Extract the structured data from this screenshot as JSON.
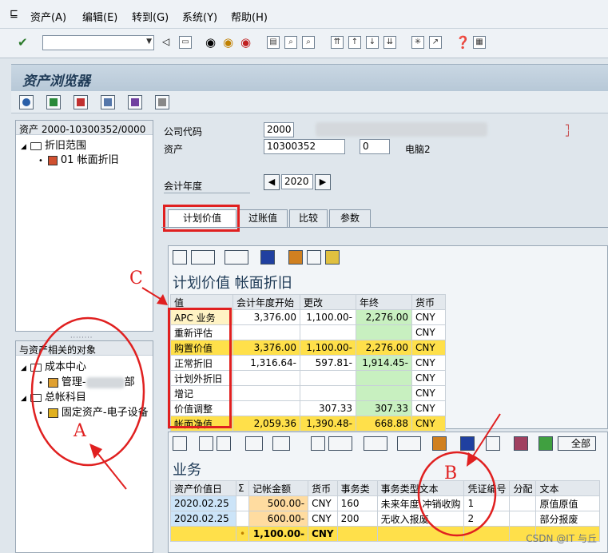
{
  "menu": [
    "资产(A)",
    "编辑(E)",
    "转到(G)",
    "系统(Y)",
    "帮助(H)"
  ],
  "title": "资产浏览器",
  "left_tree": {
    "header": "资产 2000-10300352/0000",
    "node1": "折旧范围",
    "node1_child": "01 帐面折旧"
  },
  "left_tree2": {
    "header": "与资产相关的对象",
    "node1": "成本中心",
    "node1_child_prefix": "管理-",
    "node1_child_suffix": "部",
    "node2": "总帐科目",
    "node2_child": "固定资产-电子设备"
  },
  "form": {
    "company_code_label": "公司代码",
    "company_code": "2000",
    "asset_label": "资产",
    "asset_number": "10300352",
    "asset_sub": "0",
    "asset_desc": "电脑2",
    "fiscal_year_label": "会计年度",
    "fiscal_year": "2020"
  },
  "tabs": [
    "计划价值",
    "过账值",
    "比较",
    "参数"
  ],
  "plan_section": {
    "title": "计划价值 帐面折旧",
    "headers": [
      "值",
      "会计年度开始",
      "更改",
      "年终",
      "货币"
    ],
    "rows": [
      {
        "label": "APC 业务",
        "start": "3,376.00",
        "change": "1,100.00-",
        "end": "2,276.00",
        "cur": "CNY"
      },
      {
        "label": "重新评估",
        "start": "",
        "change": "",
        "end": "",
        "cur": "CNY"
      },
      {
        "label": "购置价值",
        "start": "3,376.00",
        "change": "1,100.00-",
        "end": "2,276.00",
        "cur": "CNY"
      },
      {
        "label": "正常折旧",
        "start": "1,316.64-",
        "change": "597.81-",
        "end": "1,914.45-",
        "cur": "CNY"
      },
      {
        "label": "计划外折旧",
        "start": "",
        "change": "",
        "end": "",
        "cur": "CNY"
      },
      {
        "label": "增记",
        "start": "",
        "change": "",
        "end": "",
        "cur": "CNY"
      },
      {
        "label": "价值调整",
        "start": "",
        "change": "307.33",
        "end": "307.33",
        "cur": "CNY"
      },
      {
        "label": "帐面净值",
        "start": "2,059.36",
        "change": "1,390.48-",
        "end": "668.88",
        "cur": "CNY"
      }
    ]
  },
  "trans_section": {
    "title": "业务",
    "all_button": "全部",
    "headers": [
      "资产价值日",
      "Σ",
      "记帐金额",
      "货币",
      "事务类",
      "事务类型文本",
      "凭证编号",
      "分配",
      "文本"
    ],
    "rows": [
      {
        "date": "2020.02.25",
        "amount": "500.00-",
        "cur": "CNY",
        "type": "160",
        "type_text": "未来年度 冲销收购",
        "doc": "1",
        "text": "原值原值"
      },
      {
        "date": "2020.02.25",
        "amount": "600.00-",
        "cur": "CNY",
        "type": "200",
        "type_text": "无收入报废",
        "doc": "2",
        "text": "部分报废"
      }
    ],
    "total_marker": "•",
    "total": "1,100.00-",
    "total_cur": "CNY"
  },
  "annotations": {
    "a": "A",
    "b": "B",
    "c": "C"
  },
  "watermark": "CSDN @IT 与丘"
}
